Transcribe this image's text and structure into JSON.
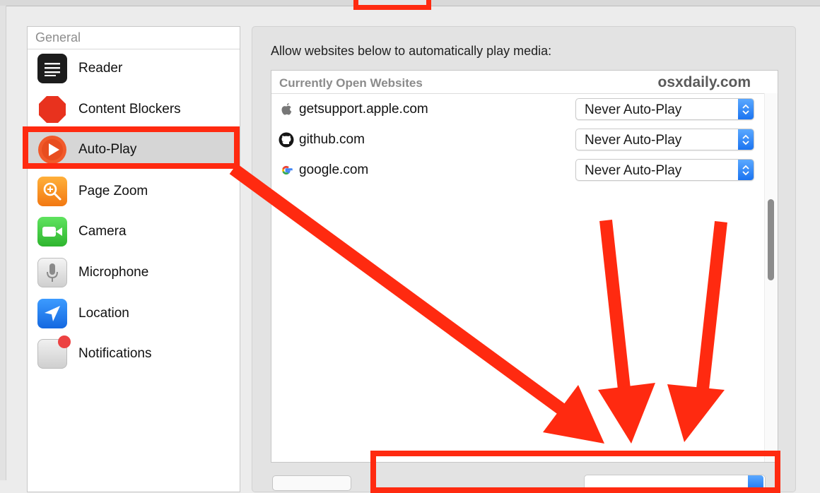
{
  "sidebar": {
    "header": "General",
    "items": [
      {
        "label": "Reader",
        "icon": "reader-icon"
      },
      {
        "label": "Content Blockers",
        "icon": "stop-sign-icon"
      },
      {
        "label": "Auto-Play",
        "icon": "play-icon",
        "selected": true
      },
      {
        "label": "Page Zoom",
        "icon": "magnifier-icon"
      },
      {
        "label": "Camera",
        "icon": "camera-icon"
      },
      {
        "label": "Microphone",
        "icon": "microphone-icon"
      },
      {
        "label": "Location",
        "icon": "location-arrow-icon"
      },
      {
        "label": "Notifications",
        "icon": "notification-badge-icon"
      }
    ]
  },
  "main": {
    "description": "Allow websites below to automatically play media:",
    "list_header": "Currently Open Websites",
    "watermark": "osxdaily.com",
    "sites": [
      {
        "name": "getsupport.apple.com",
        "icon": "apple-icon",
        "setting": "Never Auto-Play"
      },
      {
        "name": "github.com",
        "icon": "github-icon",
        "setting": "Never Auto-Play"
      },
      {
        "name": "google.com",
        "icon": "google-icon",
        "setting": "Never Auto-Play"
      }
    ]
  },
  "colors": {
    "annotation_red": "#ff2a10",
    "stepper_blue": "#1b74f1"
  }
}
